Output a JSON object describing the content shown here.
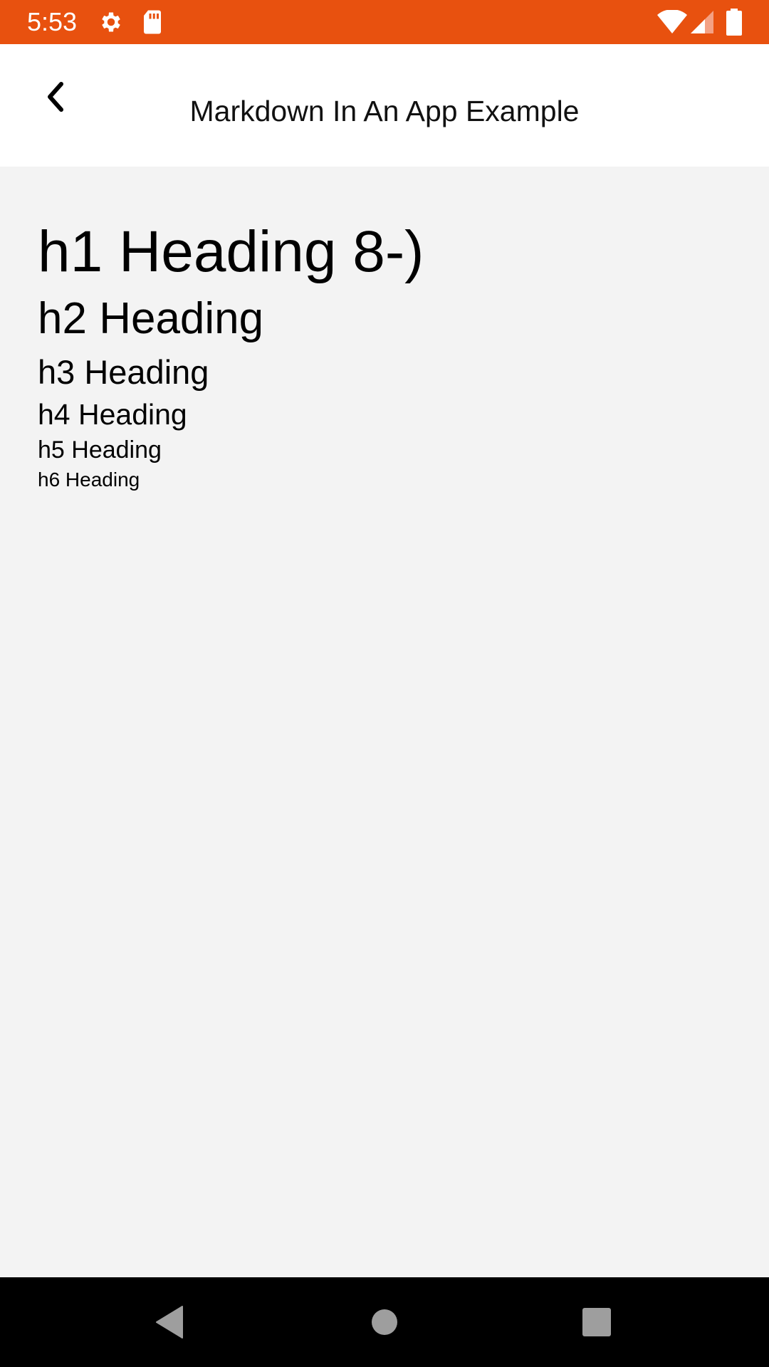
{
  "status_bar": {
    "time": "5:53",
    "icons": [
      "gear-icon",
      "sd-card-icon",
      "wifi-icon",
      "signal-icon",
      "battery-icon"
    ],
    "color": "#e8510f"
  },
  "toolbar": {
    "back_icon": "chevron-left-icon",
    "title": "Markdown In An App Example"
  },
  "content": {
    "headings": {
      "h1": "h1 Heading 8-)",
      "h2": "h2 Heading",
      "h3": "h3 Heading",
      "h4": "h4 Heading",
      "h5": "h5 Heading",
      "h6": "h6 Heading"
    }
  },
  "nav_bar": {
    "icons": [
      "nav-back-icon",
      "nav-home-icon",
      "nav-recents-icon"
    ]
  }
}
